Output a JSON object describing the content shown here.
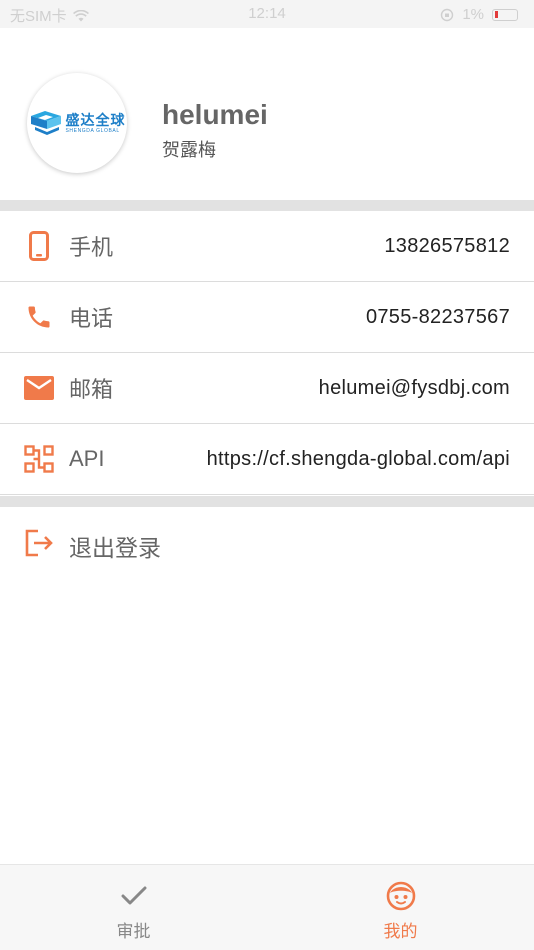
{
  "status_bar": {
    "carrier": "无SIM卡",
    "time": "12:14",
    "battery": "1%"
  },
  "profile": {
    "logo_text_cn": "盛达全球",
    "logo_text_en": "SHENGDA GLOBAL",
    "username": "helumei",
    "realname": "贺露梅"
  },
  "contact": {
    "mobile": {
      "label": "手机",
      "value": "13826575812",
      "icon": "mobile-phone-icon"
    },
    "phone": {
      "label": "电话",
      "value": "0755-82237567",
      "icon": "phone-handset-icon"
    },
    "email": {
      "label": "邮箱",
      "value": "helumei@fysdbj.com",
      "icon": "envelope-icon"
    },
    "api": {
      "label": "API",
      "value": "https://cf.shengda-global.com/api",
      "icon": "api-tree-icon"
    }
  },
  "logout": {
    "label": "退出登录",
    "icon": "logout-icon"
  },
  "tabbar": {
    "approve": {
      "label": "审批",
      "icon": "checkmark-icon"
    },
    "mine": {
      "label": "我的",
      "icon": "face-icon"
    }
  },
  "colors": {
    "accent": "#f07a4a",
    "divider": "#e2e2e2",
    "text_muted": "#666666"
  }
}
